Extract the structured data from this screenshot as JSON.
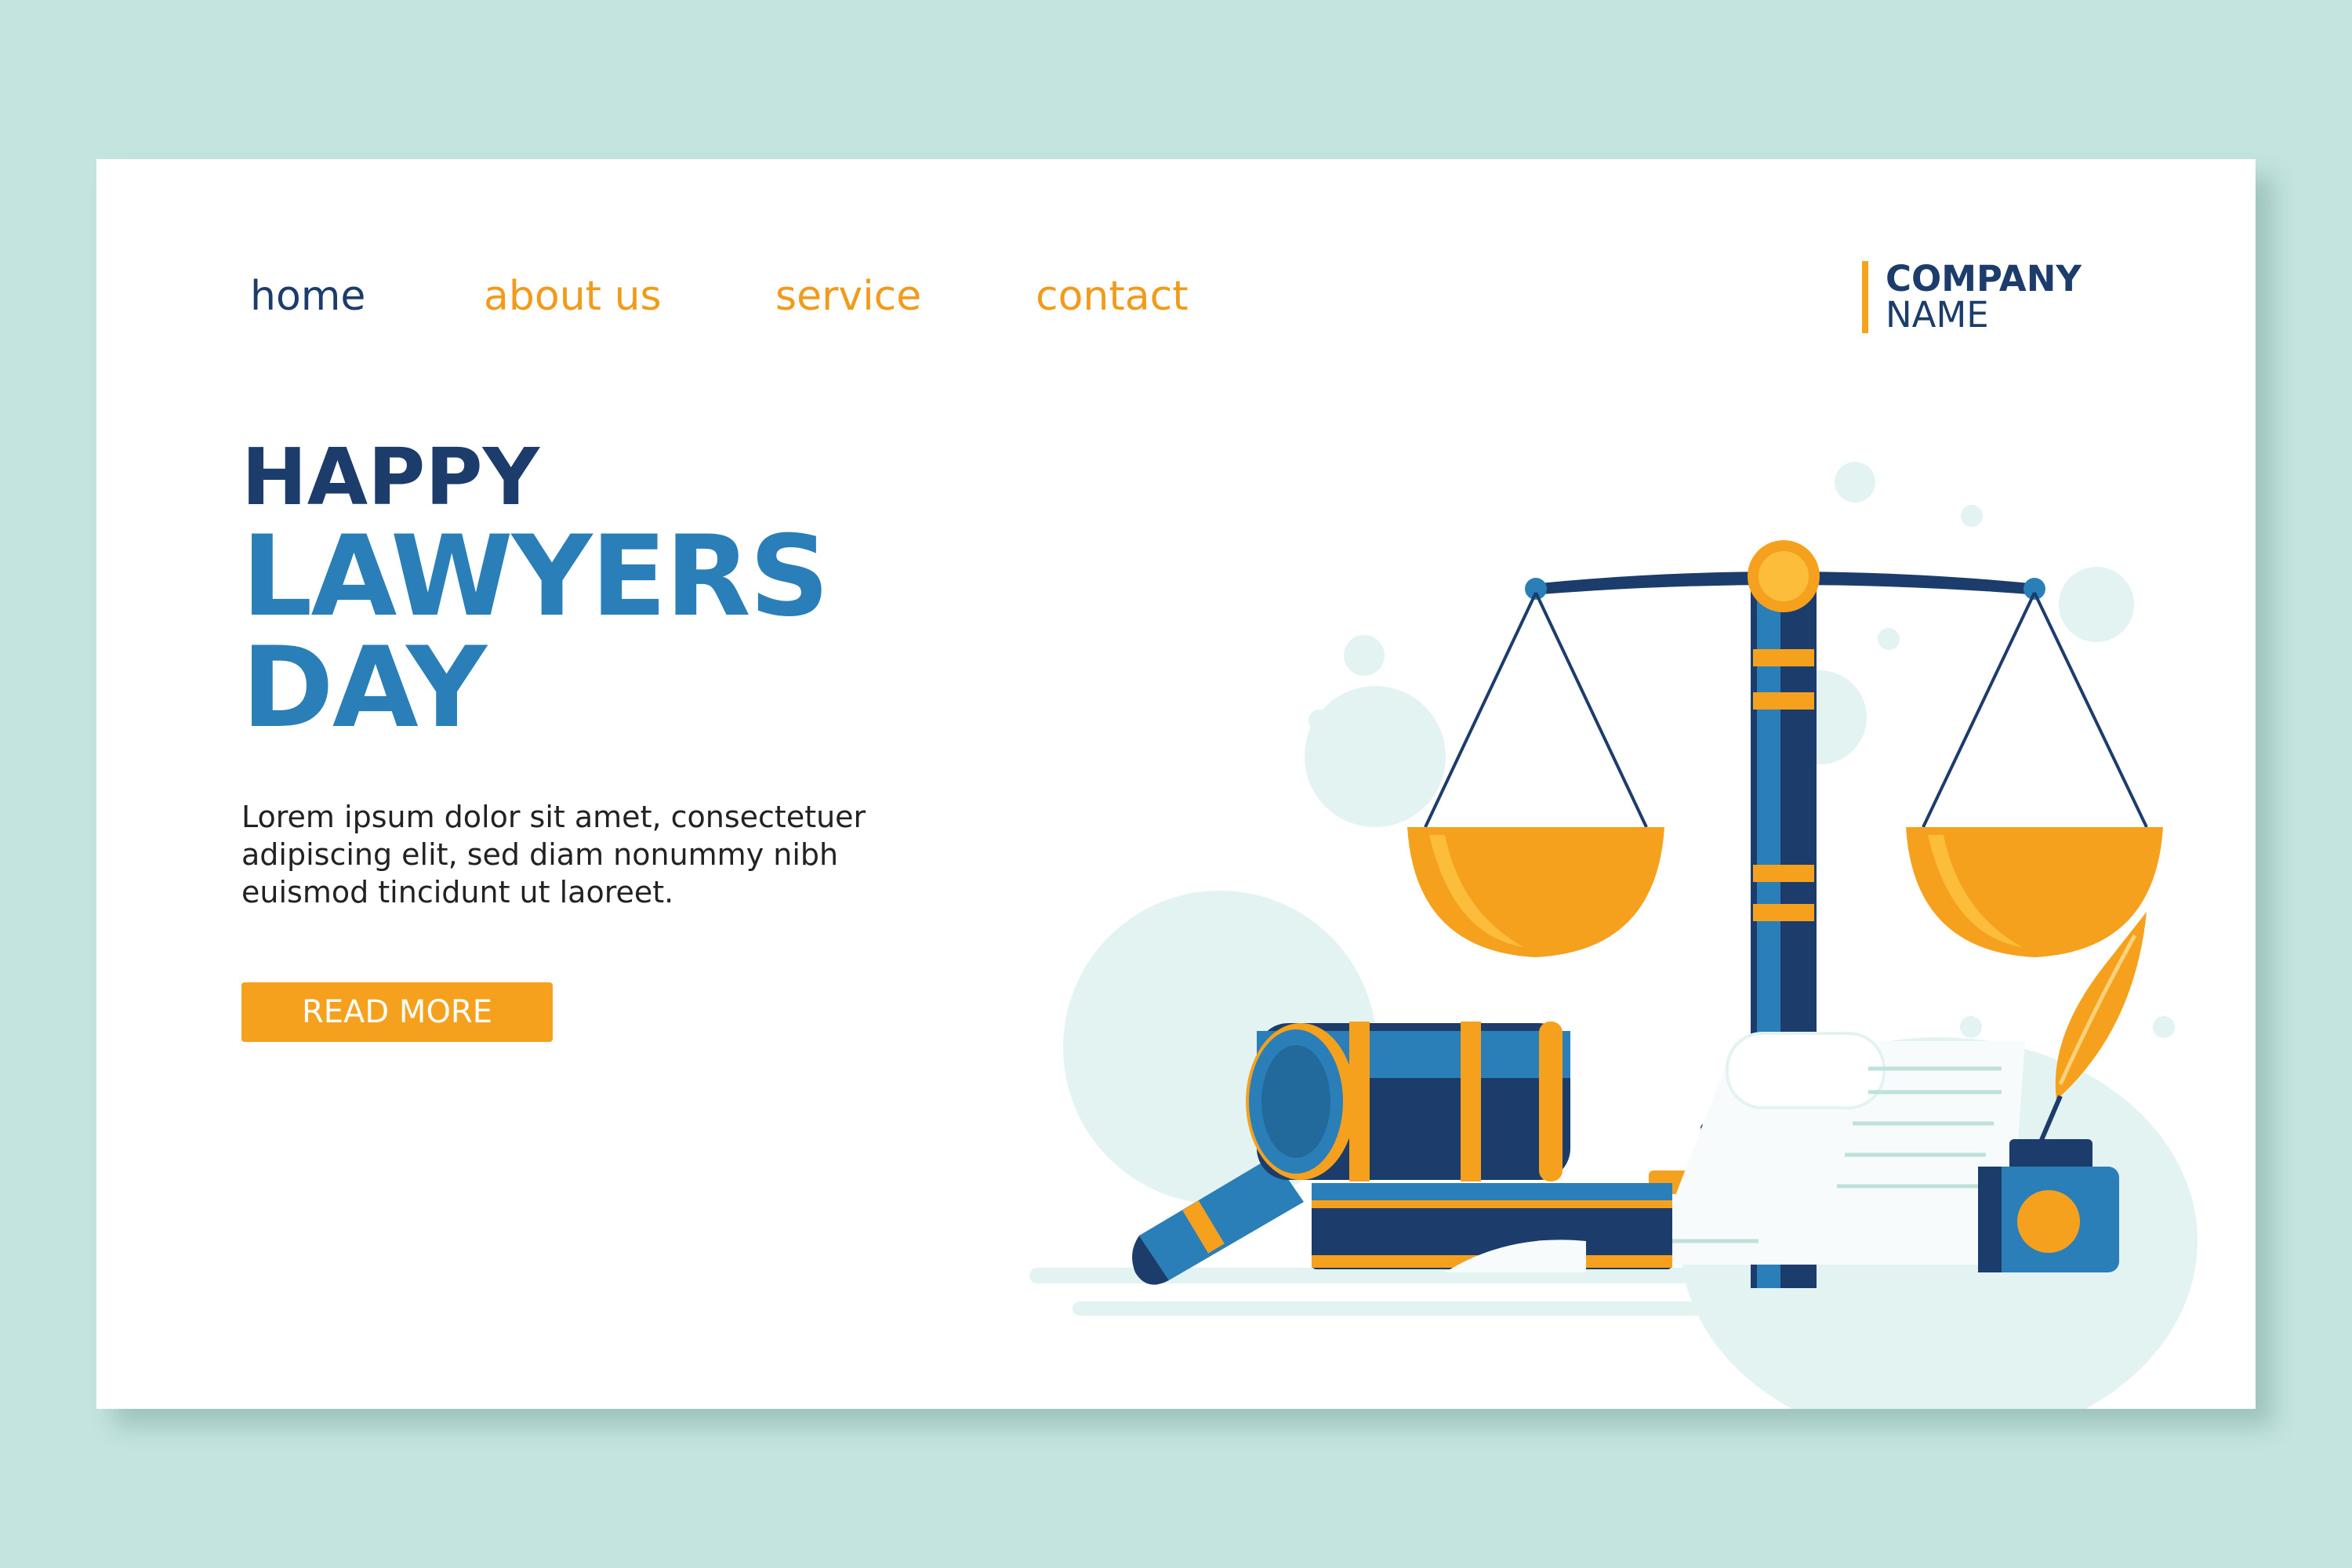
{
  "nav": {
    "items": [
      {
        "label": "home",
        "active": true
      },
      {
        "label": "about us",
        "active": false
      },
      {
        "label": "service",
        "active": false
      },
      {
        "label": "contact",
        "active": false
      }
    ]
  },
  "brand": {
    "line1": "COMPANY",
    "line2": "NAME"
  },
  "hero": {
    "kicker": "HAPPY",
    "title_line1": "LAWYERS",
    "title_line2": "DAY",
    "body_line1": "Lorem ipsum dolor sit amet, consectetuer",
    "body_line2": "adipiscing elit, sed diam nonummy nibh",
    "body_line3": "euismod tincidunt ut laoreet.",
    "cta_label": "READ MORE"
  },
  "colors": {
    "background": "#c4e4df",
    "navy": "#1c3d6c",
    "blue": "#2a7fb8",
    "orange": "#f29a1a",
    "gold": "#f6a11d"
  },
  "illustration": {
    "items": [
      "scales-of-justice",
      "judge-gavel",
      "law-book",
      "scroll-document",
      "quill-pen",
      "ink-bottle"
    ]
  }
}
